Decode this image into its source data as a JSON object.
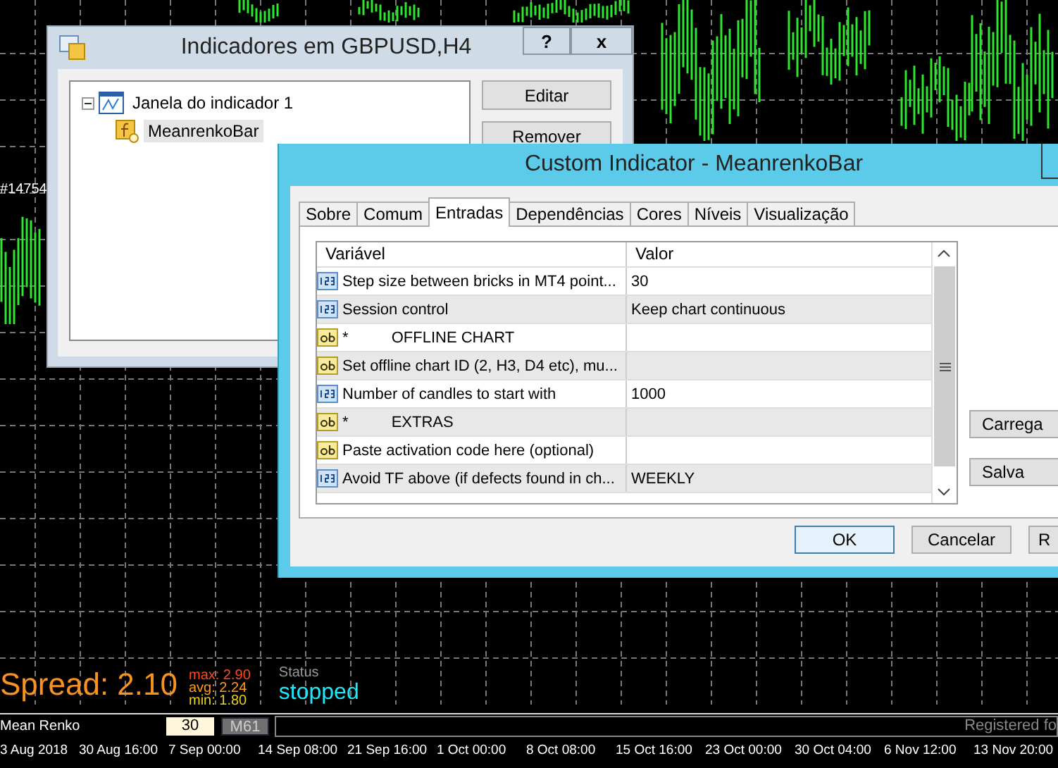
{
  "chart": {
    "marker_label": "#14754"
  },
  "indicators_window": {
    "title": "Indicadores em GBPUSD,H4",
    "title_buttons": [
      "?",
      "x"
    ],
    "tree": [
      {
        "label": "Janela do indicador 1",
        "expanded": true,
        "children": [
          {
            "label": "MeanrenkoBar",
            "selected": true
          }
        ]
      }
    ],
    "buttons": [
      "Editar",
      "Remover"
    ]
  },
  "custom_indicator_window": {
    "title": "Custom Indicator - MeanrenkoBar",
    "tabs": [
      {
        "label": "Sobre",
        "selected": false
      },
      {
        "label": "Comum",
        "selected": false
      },
      {
        "label": "Entradas",
        "selected": true
      },
      {
        "label": "Dependências",
        "selected": false
      },
      {
        "label": "Cores",
        "selected": false
      },
      {
        "label": "Níveis",
        "selected": false
      },
      {
        "label": "Visualização",
        "selected": false
      }
    ],
    "table": {
      "columns": [
        "Variável",
        "Valor"
      ],
      "rows": [
        {
          "kind": "int",
          "name": "Step size between bricks in MT4 point...",
          "value": "30"
        },
        {
          "kind": "int",
          "name": "Session control",
          "value": "Keep chart continuous"
        },
        {
          "kind": "string",
          "name": "*          OFFLINE CHART"
        },
        {
          "kind": "string",
          "name": "Set offline chart ID (2, H3, D4 etc), mu..."
        },
        {
          "kind": "int",
          "name": "Number of candles to start with",
          "value": "1000"
        },
        {
          "kind": "string",
          "name": "*          EXTRAS"
        },
        {
          "kind": "string",
          "name": "Paste activation code here (optional)"
        },
        {
          "kind": "int",
          "name": "Avoid TF above (if defects found in ch...",
          "value": "WEEKLY"
        }
      ]
    },
    "side_buttons": [
      "Carrega",
      "Salva"
    ],
    "buttons": [
      {
        "label": "OK",
        "default": true
      },
      {
        "label": "Cancelar",
        "default": false
      },
      {
        "label": "R",
        "default": false
      }
    ]
  },
  "spread": {
    "label": "Spread: 2.10",
    "stats": [
      {
        "text": "max: 2.90",
        "color": "#ff4a1c"
      },
      {
        "text": "avg: 2.24",
        "color": "#ff9a1a"
      },
      {
        "text": "min: 1.80",
        "color": "#e8d21a"
      }
    ],
    "status_label": "Status",
    "status": "stopped"
  },
  "panel": {
    "name": "Mean Renko",
    "period": "30",
    "timeframe": "M61",
    "registration": "Registered fo"
  },
  "time_axis": [
    "3 Aug 2018",
    "30 Aug 16:00",
    "7 Sep 00:00",
    "14 Sep 08:00",
    "21 Sep 16:00",
    "1 Oct 00:00",
    "8 Oct 08:00",
    "15 Oct 16:00",
    "23 Oct 00:00",
    "30 Oct 04:00",
    "6 Nov 12:00",
    "13 Nov 20:00"
  ]
}
